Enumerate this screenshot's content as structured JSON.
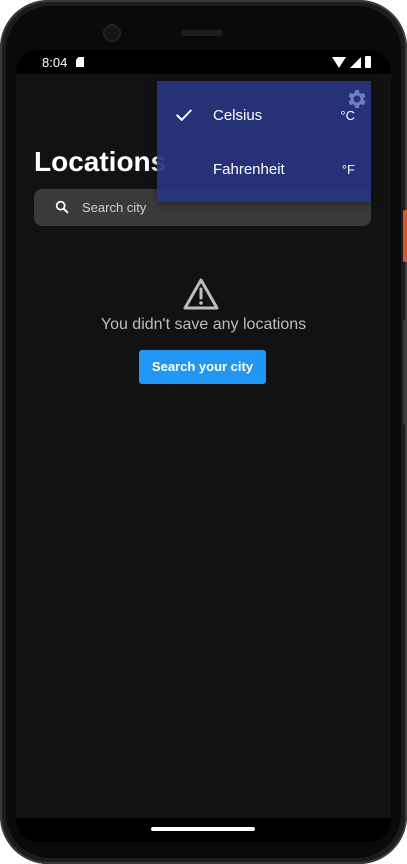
{
  "status_bar": {
    "time": "8:04"
  },
  "header": {
    "title": "Locations"
  },
  "search": {
    "placeholder": "Search city"
  },
  "empty_state": {
    "message": "You didn't save any locations",
    "button_label": "Search your city",
    "icon": "warning-triangle-icon"
  },
  "unit_menu": {
    "items": [
      {
        "label": "Celsius",
        "unit": "°C",
        "selected": true
      },
      {
        "label": "Fahrenheit",
        "unit": "°F",
        "selected": false
      }
    ]
  },
  "colors": {
    "background": "#121212",
    "accent": "#2196f3",
    "menu_background": "#293480"
  }
}
